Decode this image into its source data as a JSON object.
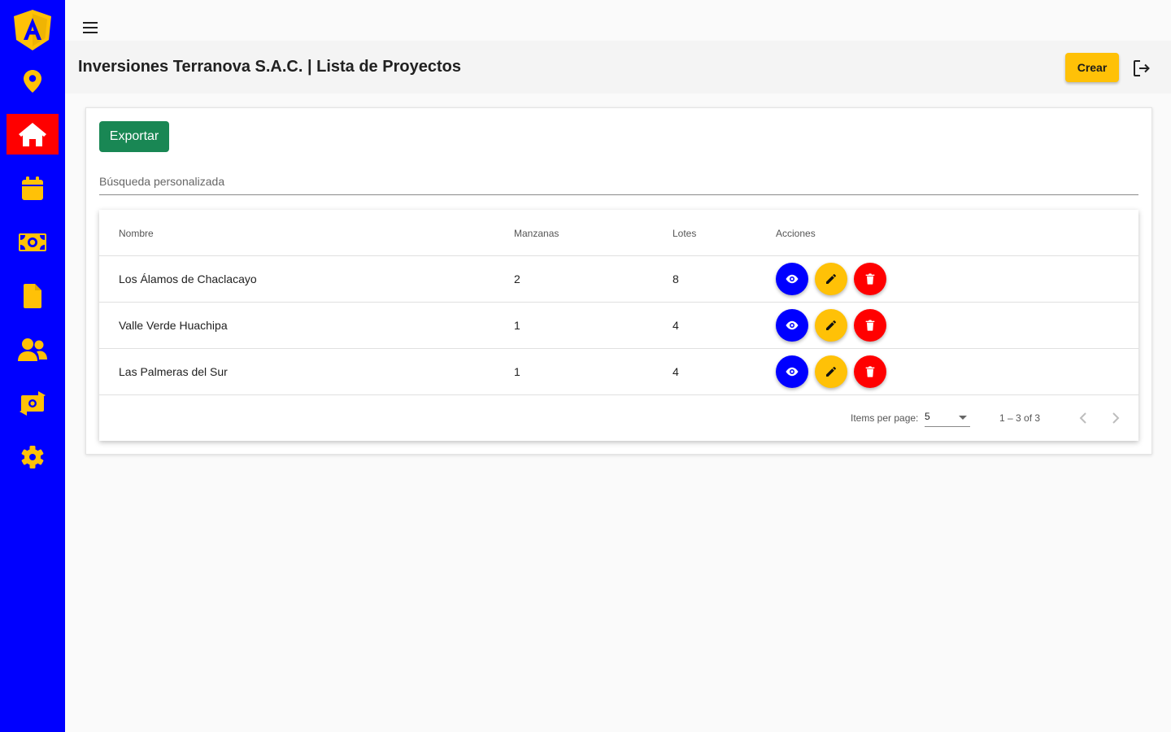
{
  "colors": {
    "sidebar_bg": "#0000ff",
    "sidebar_active": "#ff0000",
    "icon_yellow": "#ffc107",
    "export_green": "#198754",
    "view_blue": "#0000ff",
    "delete_red": "#ff0000"
  },
  "sidebar": {
    "logo_letter": "A",
    "items": [
      {
        "icon": "location-pin-icon"
      },
      {
        "icon": "home-icon",
        "active": true
      },
      {
        "icon": "calendar-icon"
      },
      {
        "icon": "money-bill-icon"
      },
      {
        "icon": "file-icon"
      },
      {
        "icon": "users-icon"
      },
      {
        "icon": "money-exchange-icon"
      },
      {
        "icon": "gear-icon"
      }
    ]
  },
  "header": {
    "title": "Inversiones Terranova S.A.C. | Lista de Proyectos",
    "create_label": "Crear"
  },
  "toolbar": {
    "export_label": "Exportar",
    "search_placeholder": "Búsqueda personalizada"
  },
  "table": {
    "columns": [
      "Nombre",
      "Manzanas",
      "Lotes",
      "Acciones"
    ],
    "rows": [
      {
        "nombre": "Los Álamos de Chaclacayo",
        "manzanas": "2",
        "lotes": "8"
      },
      {
        "nombre": "Valle Verde Huachipa",
        "manzanas": "1",
        "lotes": "4"
      },
      {
        "nombre": "Las Palmeras del Sur",
        "manzanas": "1",
        "lotes": "4"
      }
    ]
  },
  "paginator": {
    "items_per_page_label": "Items per page:",
    "page_size": "5",
    "range_label": "1 – 3 of 3"
  }
}
